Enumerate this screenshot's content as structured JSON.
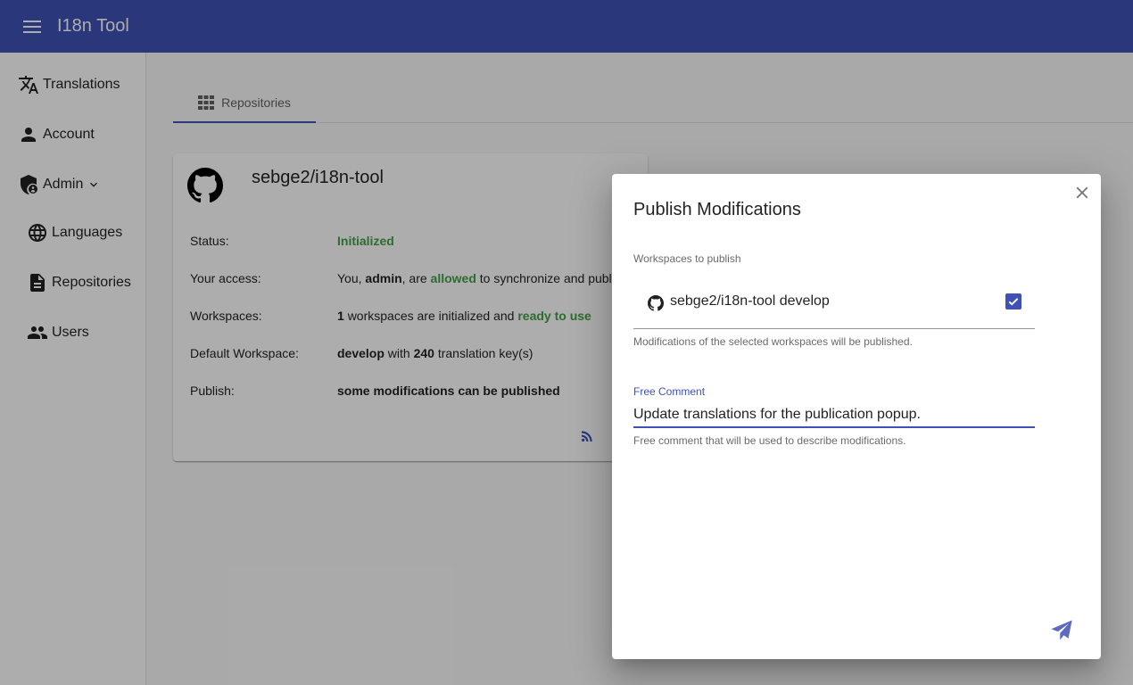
{
  "app": {
    "title": "I18n Tool",
    "accent": "#3f51b5"
  },
  "sidebar": {
    "items": [
      {
        "label": "Translations",
        "icon": "translate-icon"
      },
      {
        "label": "Account",
        "icon": "person-icon"
      },
      {
        "label": "Admin",
        "icon": "admin-shield-icon",
        "expanded": true
      },
      {
        "label": "Languages",
        "icon": "globe-icon"
      },
      {
        "label": "Repositories",
        "icon": "document-icon"
      },
      {
        "label": "Users",
        "icon": "people-icon"
      }
    ]
  },
  "tabs": [
    {
      "label": "Repositories",
      "icon": "grid-icon",
      "active": true
    }
  ],
  "repository_card": {
    "name": "sebge2/i18n-tool",
    "status_label": "Status:",
    "status_value": "Initialized",
    "access_label": "Your access:",
    "access_prefix": "You,",
    "access_user": "admin",
    "access_mid": ", are",
    "access_allowed": "allowed",
    "access_suffix": "to synchronize and publ",
    "workspaces_label": "Workspaces:",
    "workspaces_count": "1",
    "workspaces_text": "workspaces are initialized and",
    "workspaces_ready": "ready to use",
    "default_ws_label": "Default Workspace:",
    "default_ws_name": "develop",
    "default_ws_with": "with",
    "default_ws_count": "240",
    "default_ws_suffix": "translation key(s)",
    "publish_label": "Publish:",
    "publish_value": "some modifications can be published"
  },
  "dialog": {
    "title": "Publish Modifications",
    "workspaces_label": "Workspaces to publish",
    "workspace_item": "sebge2/i18n-tool develop",
    "workspace_checked": true,
    "workspaces_hint": "Modifications of the selected workspaces will be published.",
    "comment_label": "Free Comment",
    "comment_value": "Update translations for the publication popup.",
    "comment_hint": "Free comment that will be used to describe modifications."
  }
}
